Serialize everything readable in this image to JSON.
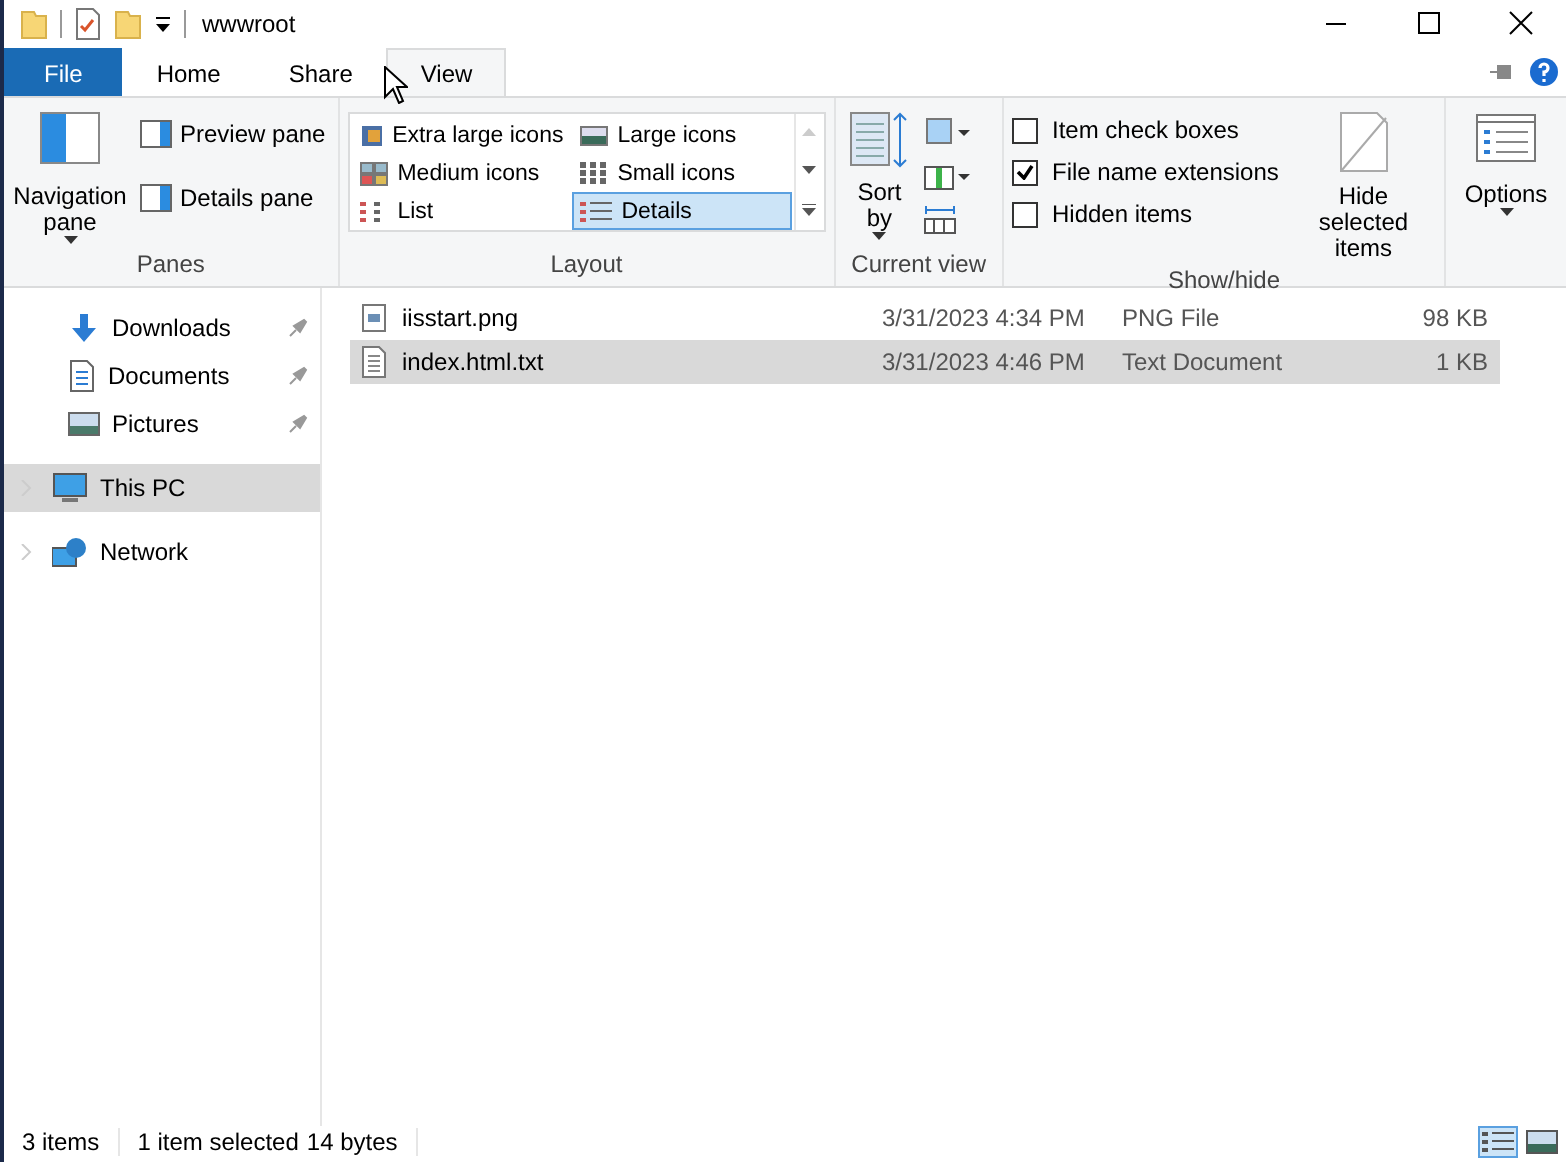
{
  "window": {
    "title": "wwwroot"
  },
  "ribbon": {
    "tabs": [
      {
        "label": "File",
        "kind": "file",
        "selected": false
      },
      {
        "label": "Home",
        "kind": "tab",
        "selected": false
      },
      {
        "label": "Share",
        "kind": "tab",
        "selected": false
      },
      {
        "label": "View",
        "kind": "tab",
        "selected": true
      }
    ],
    "panes": {
      "title": "Panes",
      "navigation_pane": "Navigation pane",
      "preview_pane": "Preview pane",
      "details_pane": "Details pane"
    },
    "layout": {
      "title": "Layout",
      "options": [
        {
          "label": "Extra large icons",
          "kind": "xl",
          "selected": false
        },
        {
          "label": "Large icons",
          "kind": "large",
          "selected": false
        },
        {
          "label": "Medium icons",
          "kind": "medium",
          "selected": false
        },
        {
          "label": "Small icons",
          "kind": "small",
          "selected": false
        },
        {
          "label": "List",
          "kind": "list",
          "selected": false
        },
        {
          "label": "Details",
          "kind": "details",
          "selected": true
        }
      ]
    },
    "current_view": {
      "title": "Current view",
      "sort_by": "Sort by"
    },
    "show_hide": {
      "title": "Show/hide",
      "checkboxes": [
        {
          "label": "Item check boxes",
          "checked": false
        },
        {
          "label": "File name extensions",
          "checked": true
        },
        {
          "label": "Hidden items",
          "checked": false
        }
      ],
      "hide_selected": "Hide selected items"
    },
    "options": {
      "label": "Options"
    }
  },
  "navigation": {
    "items": [
      {
        "label": "Downloads",
        "kind": "downloads",
        "pinned": true,
        "selected": false
      },
      {
        "label": "Documents",
        "kind": "documents",
        "pinned": true,
        "selected": false
      },
      {
        "label": "Pictures",
        "kind": "pictures",
        "pinned": true,
        "selected": false
      },
      {
        "label": "This PC",
        "kind": "pc",
        "pinned": false,
        "selected": true
      },
      {
        "label": "Network",
        "kind": "network",
        "pinned": false,
        "selected": false
      }
    ]
  },
  "files": {
    "rows": [
      {
        "name": "iisstart.png",
        "kind": "image",
        "date": "3/31/2023 4:34 PM",
        "type": "PNG File",
        "size": "98 KB",
        "selected": false
      },
      {
        "name": "index.html.txt",
        "kind": "text",
        "date": "3/31/2023 4:46 PM",
        "type": "Text Document",
        "size": "1 KB",
        "selected": true
      }
    ]
  },
  "status_bar": {
    "item_count": "3 items",
    "selection": "1 item selected",
    "selection_size": "14 bytes",
    "view_buttons": [
      {
        "kind": "details",
        "selected": true
      },
      {
        "kind": "large",
        "selected": false
      }
    ]
  }
}
